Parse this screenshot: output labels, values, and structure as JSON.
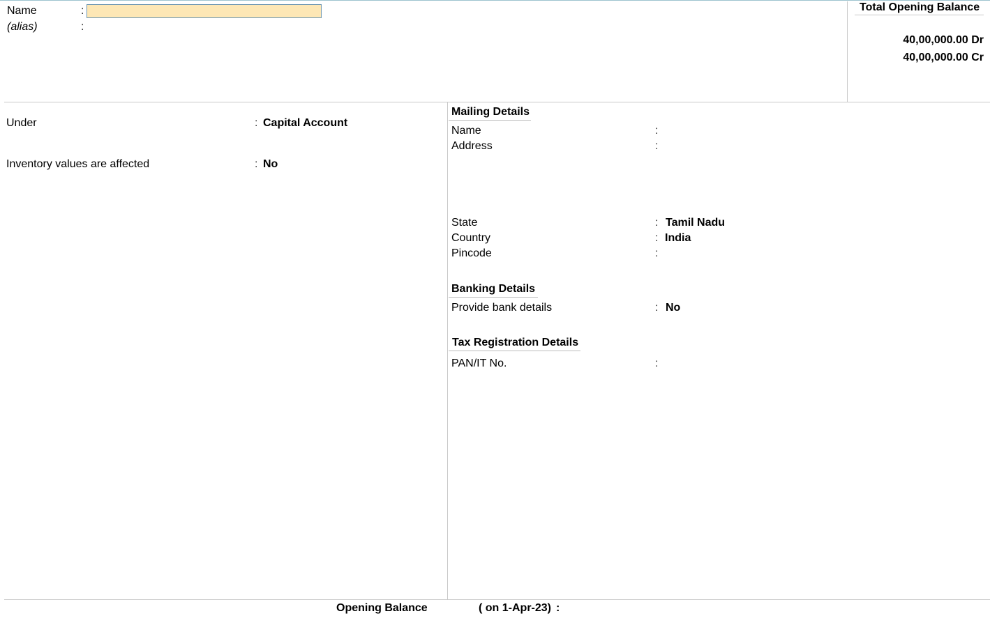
{
  "header": {
    "name_label": "Name",
    "name_colon": ":",
    "name_value": "",
    "alias_label": "(alias)",
    "alias_colon": ":"
  },
  "opening_summary": {
    "title": "Total Opening Balance",
    "debit_total": "40,00,000.00 Dr",
    "credit_total": "40,00,000.00 Cr"
  },
  "left_panel": {
    "under_label": "Under",
    "under_colon": ":",
    "under_value": "Capital Account",
    "inventory_label": "Inventory values are affected",
    "inventory_colon": ":",
    "inventory_value": "No"
  },
  "mailing": {
    "heading": "Mailing Details",
    "name_label": "Name",
    "name_colon": ":",
    "address_label": "Address",
    "address_colon": ":",
    "state_label": "State",
    "state_colon": ":",
    "state_value": "Tamil Nadu",
    "country_label": "Country",
    "country_colon": ":",
    "country_value": "India",
    "pincode_label": "Pincode",
    "pincode_colon": ":"
  },
  "banking": {
    "heading": "Banking Details",
    "provide_label": "Provide bank details",
    "provide_colon": ":",
    "provide_value": "No"
  },
  "tax": {
    "heading": "Tax Registration Details",
    "pan_label": "PAN/IT No.",
    "pan_colon": ":"
  },
  "footer": {
    "opening_label": "Opening Balance",
    "opening_date": "( on 1-Apr-23)",
    "opening_colon": ":"
  }
}
